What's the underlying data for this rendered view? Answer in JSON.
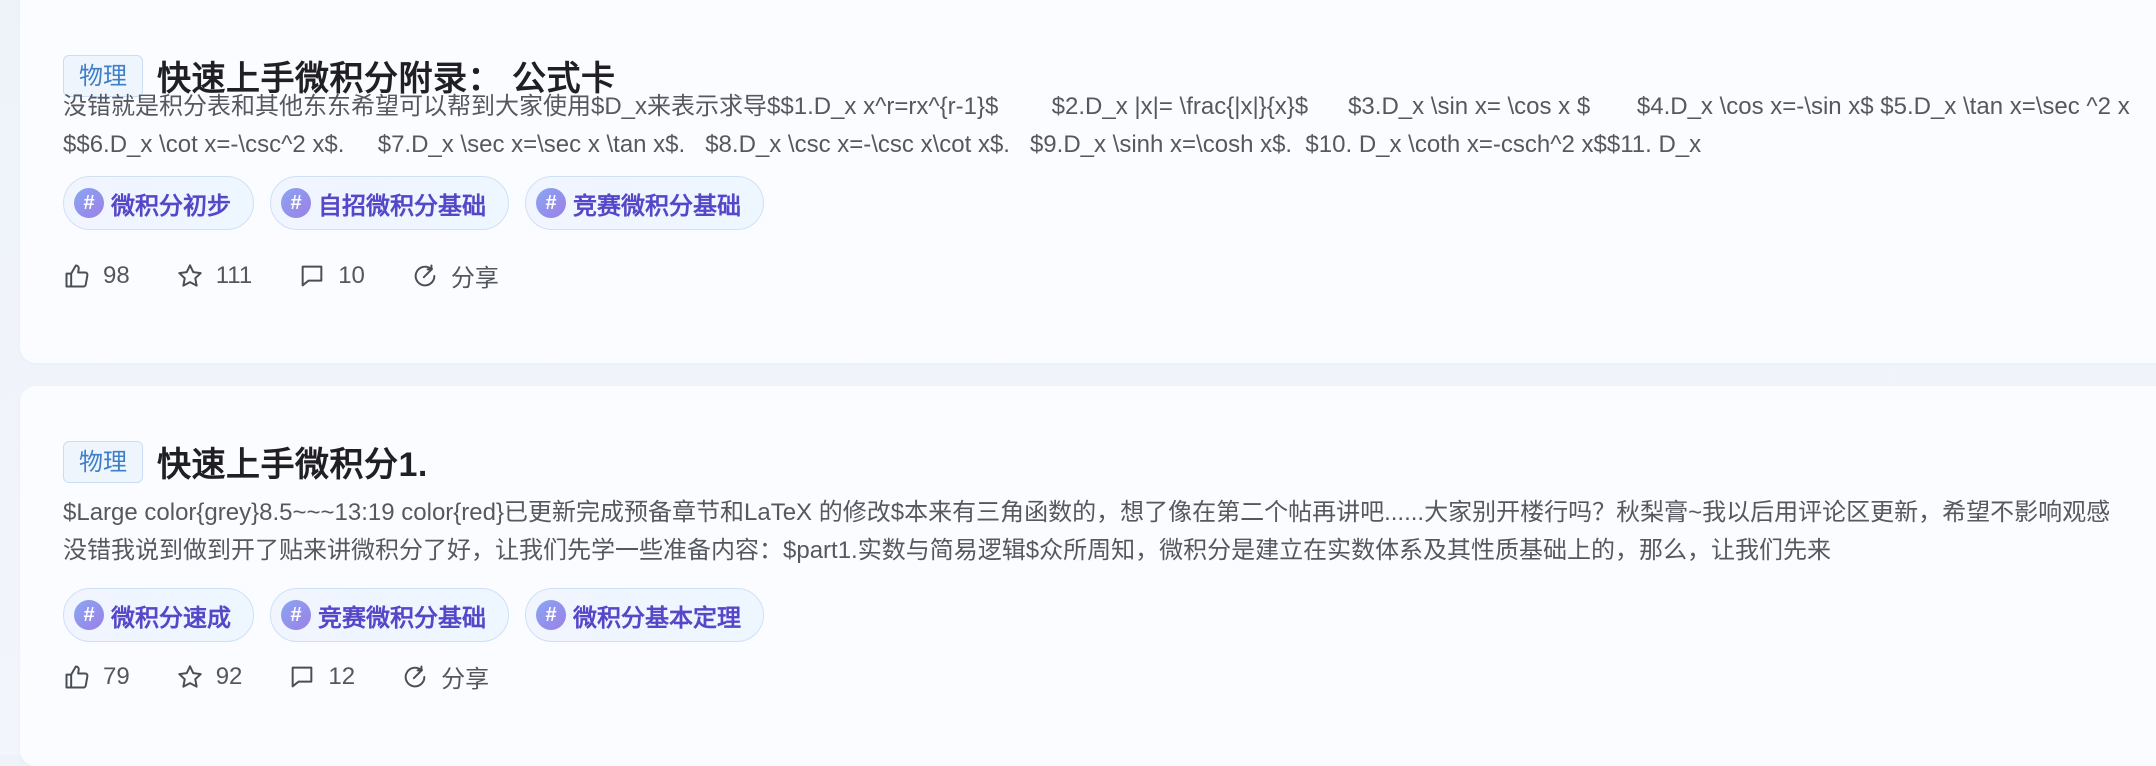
{
  "posts": [
    {
      "category": "物理",
      "title": "快速上手微积分附录： 公式卡",
      "excerpt": "没错就是积分表和其他东东希望可以帮到大家使用$D_x来表示求导$$1.D_x x^r=rx^{r-1}$        $2.D_x |x|= \\frac{|x|}{x}$      $3.D_x \\sin x= \\cos x $       $4.D_x \\cos x=-\\sin x$ $5.D_x \\tan x=\\sec ^2 x$$6.D_x \\cot x=-\\csc^2 x$.     $7.D_x \\sec x=\\sec x \\tan x$.   $8.D_x \\csc x=-\\csc x\\cot x$.   $9.D_x \\sinh x=\\cosh x$.  $10. D_x \\coth x=-csch^2 x$$11. D_x",
      "tags": [
        "微积分初步",
        "自招微积分基础",
        "竞赛微积分基础"
      ],
      "likes": "98",
      "favorites": "111",
      "comments": "10",
      "share_label": "分享"
    },
    {
      "category": "物理",
      "title": "快速上手微积分1.",
      "excerpt": "$Large color{grey}8.5~~~13:19 color{red}已更新完成预备章节和LaTeX 的修改$本来有三角函数的，想了像在第二个帖再讲吧......大家别开楼行吗？秋梨膏~我以后用评论区更新，希望不影响观感没错我说到做到开了贴来讲微积分了好，让我们先学一些准备内容：$part1.实数与简易逻辑$众所周知，微积分是建立在实数体系及其性质基础上的，那么，让我们先来",
      "tags": [
        "微积分速成",
        "竞赛微积分基础",
        "微积分基本定理"
      ],
      "likes": "79",
      "favorites": "92",
      "comments": "12",
      "share_label": "分享"
    }
  ],
  "icons": {
    "like": "thumbs-up-icon",
    "favorite": "star-icon",
    "comment": "comment-icon",
    "share": "share-icon",
    "tag": "hash-icon"
  },
  "colors": {
    "category_text": "#3d7fc8",
    "tag_text": "#5647c8",
    "title_text": "#1f1f24"
  }
}
